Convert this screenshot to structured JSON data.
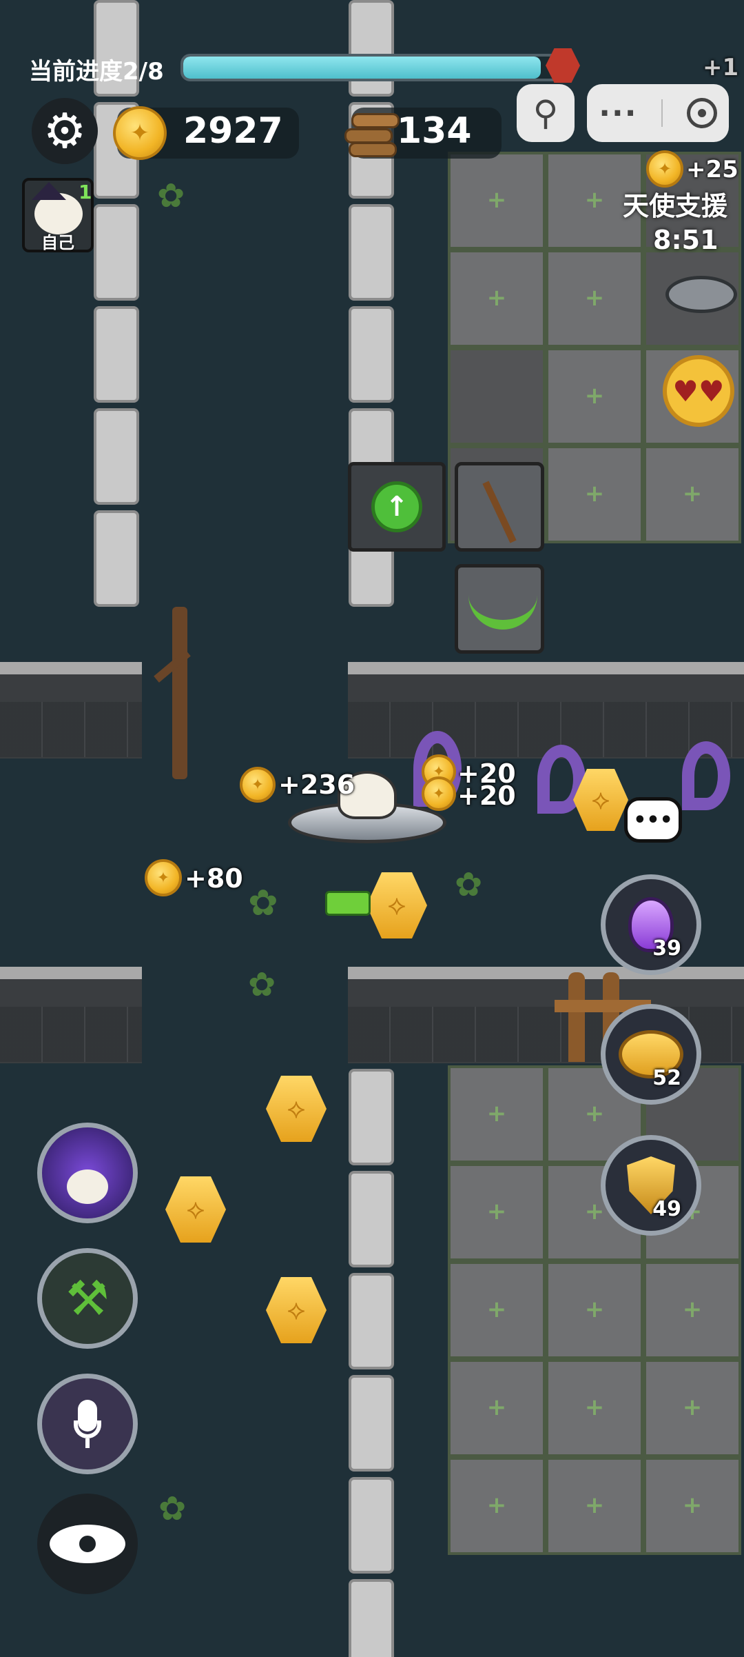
{
  "hud": {
    "progress_label": "当前进度2/8",
    "progress_fraction": 0.94,
    "coins": "2927",
    "wood": "134",
    "player_level": "1",
    "player_name": "自己"
  },
  "event": {
    "title": "天使支援",
    "timer": "8:51",
    "corner_bonus": "+25",
    "corner_bonus_top": "+1"
  },
  "floating_rewards": {
    "a": "+236",
    "b": "+20",
    "c": "+20",
    "d": "+80"
  },
  "items": {
    "potion_count": "39",
    "piggy_count": "52",
    "shield_count": "49"
  },
  "icons": {
    "settings": "gear-icon",
    "joystick": "joystick-icon",
    "more": "more-icon",
    "record": "target-icon",
    "chat": "chat-bubble-icon",
    "tools": "wrench-hammer-icon",
    "mic": "microphone-icon",
    "eye": "eye-icon"
  },
  "colors": {
    "progress_fill": "#4fbfcc",
    "coin": "#f2b526",
    "accent_green": "#5fbf3a"
  }
}
